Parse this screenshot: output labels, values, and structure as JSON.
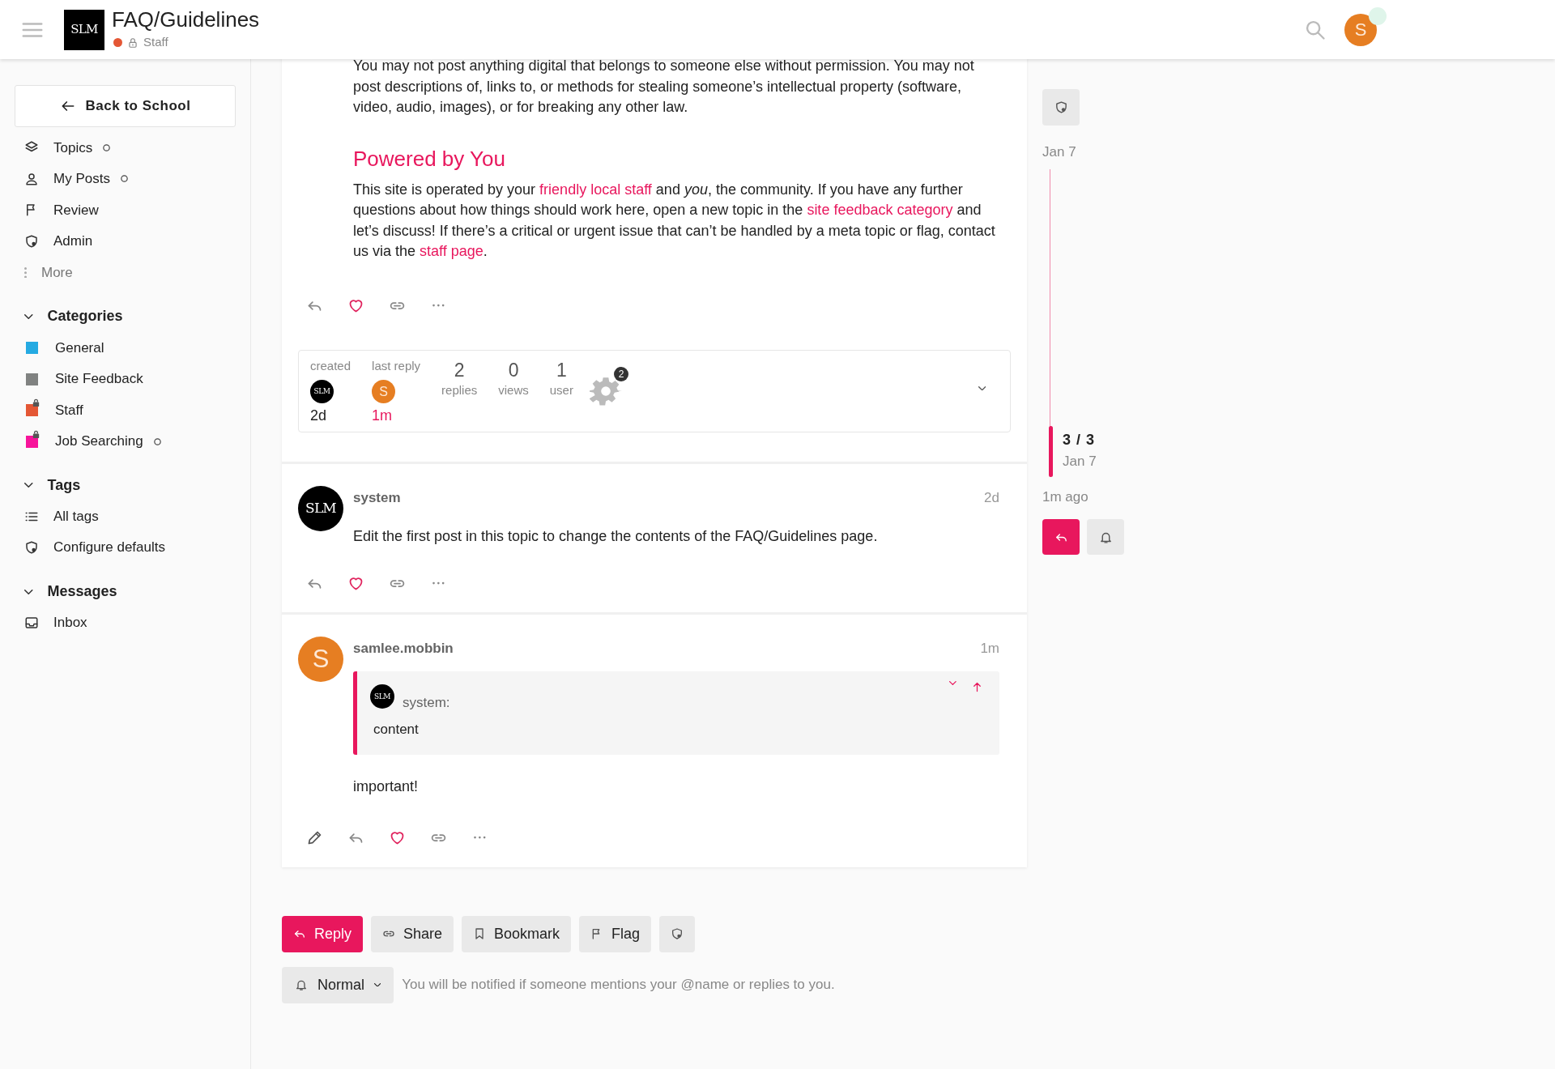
{
  "header": {
    "logo_text": "SLM",
    "title": "FAQ/Guidelines",
    "category": {
      "name": "Staff",
      "color": "#e45735",
      "locked": true
    },
    "user_avatar": {
      "kind": "letter",
      "text": "S",
      "color": "#e67e22"
    }
  },
  "sidebar": {
    "back_button": "Back to School",
    "items": [
      {
        "label": "Topics",
        "kind": "link",
        "unread": true
      },
      {
        "label": "My Posts",
        "kind": "link",
        "unread": true
      },
      {
        "label": "Review",
        "kind": "link",
        "unread": false
      },
      {
        "label": "Admin",
        "kind": "link",
        "unread": false
      },
      {
        "label": "More",
        "kind": "more",
        "unread": false
      }
    ],
    "sections": [
      {
        "title": "Categories",
        "expanded": true,
        "items": [
          {
            "label": "General",
            "kind": "category",
            "color": "#25aae2",
            "locked": false,
            "unread": false
          },
          {
            "label": "Site Feedback",
            "kind": "category",
            "color": "#808281",
            "locked": false,
            "unread": false
          },
          {
            "label": "Staff",
            "kind": "category",
            "color": "#e45735",
            "locked": true,
            "unread": false
          },
          {
            "label": "Job Searching",
            "kind": "category",
            "color": "#f7149b",
            "locked": true,
            "unread": true
          }
        ]
      },
      {
        "title": "Tags",
        "expanded": true,
        "items": [
          {
            "label": "All tags",
            "kind": "link",
            "unread": false
          },
          {
            "label": "Configure defaults",
            "kind": "link",
            "unread": false
          }
        ]
      },
      {
        "title": "Messages",
        "expanded": true,
        "items": [
          {
            "label": "Inbox",
            "kind": "link",
            "unread": false
          }
        ]
      }
    ]
  },
  "first_post": {
    "blocks": [
      {
        "kind": "paragraph",
        "parts": [
          {
            "kind": "text",
            "text": "You may not post anything digital that belongs to someone else without permission. You may not post descriptions of, links to, or methods for stealing someone’s intellectual property (software, video, audio, images), or for breaking any other law."
          }
        ]
      },
      {
        "kind": "heading",
        "parts": [
          {
            "kind": "text",
            "text": "Powered by You"
          }
        ]
      },
      {
        "kind": "paragraph",
        "parts": [
          {
            "kind": "text",
            "text": "This site is operated by your "
          },
          {
            "kind": "link",
            "text": "friendly local staff"
          },
          {
            "kind": "text",
            "text": " and *you*, the community. If you have any further questions about how things should work here, open a new topic in the "
          },
          {
            "kind": "link",
            "text": "site feedback category"
          },
          {
            "kind": "text",
            "text": " and let’s discuss! If there’s a critical or urgent issue that can’t be handled by a meta topic or flag, contact us via the "
          },
          {
            "kind": "link",
            "text": "staff page"
          },
          {
            "kind": "text",
            "text": "."
          }
        ]
      }
    ]
  },
  "topic_map": {
    "created": {
      "label": "created",
      "avatar": {
        "kind": "logo",
        "text": "SLM"
      },
      "time": "2d"
    },
    "last_reply": {
      "label": "last reply",
      "avatar": {
        "kind": "letter",
        "text": "S",
        "color": "#e67e22"
      },
      "time": "1m"
    },
    "stats": [
      {
        "value": "2",
        "label": "replies"
      },
      {
        "value": "0",
        "label": "views"
      },
      {
        "value": "1",
        "label": "user"
      }
    ],
    "participants": [
      {
        "count": "2"
      }
    ]
  },
  "posts": [
    {
      "author": "system",
      "avatar": {
        "kind": "logo",
        "text": "SLM"
      },
      "date": "2d",
      "editable": false,
      "body": "Edit the first post in this topic to change the contents of the FAQ/Guidelines page."
    },
    {
      "author": "samlee.mobbin",
      "avatar": {
        "kind": "letter",
        "text": "S",
        "color": "#e67e22"
      },
      "date": "1m",
      "editable": true,
      "quote": {
        "author": "system:",
        "avatar": {
          "kind": "logo",
          "text": "SLM"
        },
        "text": "content"
      },
      "body": "important!"
    }
  ],
  "footer_buttons": [
    {
      "kind": "primary",
      "label": "Reply"
    },
    {
      "kind": "share",
      "label": "Share"
    },
    {
      "kind": "bookmark",
      "label": "Bookmark"
    },
    {
      "kind": "flag",
      "label": "Flag"
    },
    {
      "kind": "admin"
    }
  ],
  "notification": {
    "level": "Normal",
    "description": "You will be notified if someone mentions your @name or replies to you."
  },
  "timeline": {
    "start_date": "Jan 7",
    "position": "3 / 3",
    "position_date": "Jan 7",
    "last_activity": "1m ago"
  }
}
